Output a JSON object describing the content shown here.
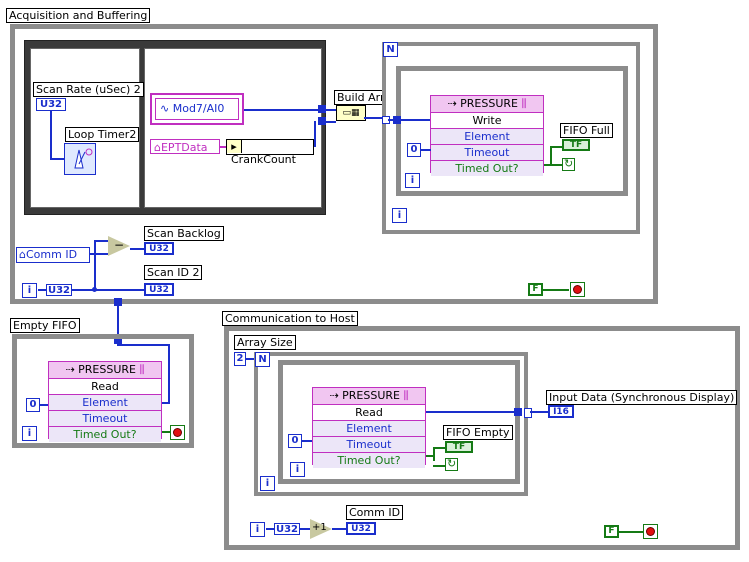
{
  "labels": {
    "acq_loop": "Acquisition and Buffering",
    "scan_rate": "Scan Rate (uSec) 2",
    "loop_timer": "Loop Timer2",
    "mod_io": "Mod7/AI0",
    "ept_data": "EPTData",
    "crank_count": "CrankCount",
    "build_array": "Build Array",
    "fifo_full": "FIFO Full",
    "comm_id": "Comm ID",
    "scan_backlog": "Scan Backlog",
    "scan_id": "Scan ID 2",
    "empty_fifo": "Empty FIFO",
    "comm_host": "Communication to Host",
    "array_size": "Array Size",
    "fifo_empty": "FIFO Empty",
    "input_data": "Input Data (Synchronous Display)",
    "comm_id_ind": "Comm ID"
  },
  "fifo_write": {
    "name": "PRESSURE",
    "mode": "Write",
    "element": "Element",
    "timeout": "Timeout",
    "timed_out": "Timed Out?"
  },
  "fifo_read_empty": {
    "name": "PRESSURE",
    "mode": "Read",
    "element": "Element",
    "timeout": "Timeout",
    "timed_out": "Timed Out?"
  },
  "fifo_read_host": {
    "name": "PRESSURE",
    "mode": "Read",
    "element": "Element",
    "timeout": "Timeout",
    "timed_out": "Timed Out?"
  },
  "terms": {
    "u32": "U32",
    "i16": "I16",
    "n": "N",
    "i": "i",
    "zero": "0",
    "two": "2",
    "f": "F",
    "tf": "TF",
    "plus1": "+1",
    "minus": "−"
  }
}
